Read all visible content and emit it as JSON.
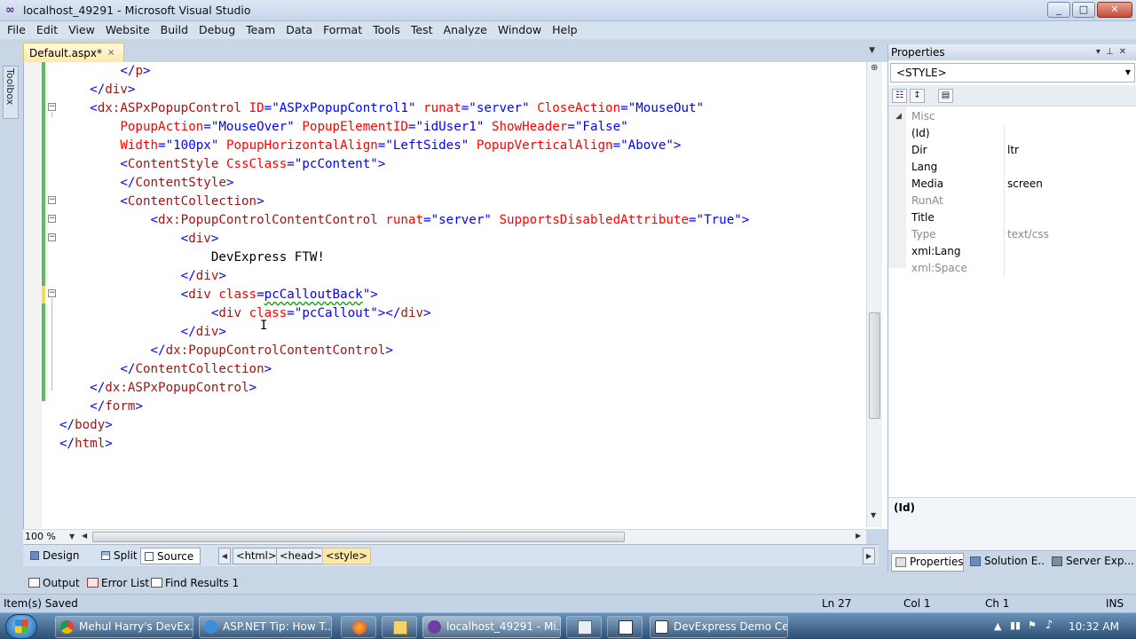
{
  "window": {
    "title": "localhost_49291 - Microsoft Visual Studio",
    "controls": [
      "_",
      "□",
      "✕"
    ]
  },
  "menu": [
    "File",
    "Edit",
    "View",
    "Website",
    "Build",
    "Debug",
    "Team",
    "Data",
    "Format",
    "Tools",
    "Test",
    "Analyze",
    "Window",
    "Help"
  ],
  "tab": {
    "label": "Default.aspx*",
    "close": "×"
  },
  "toolbox": {
    "label": "Toolbox"
  },
  "code": {
    "lines": [
      [
        {
          "c": "",
          "t": "        "
        },
        {
          "c": "b",
          "t": "</"
        },
        {
          "c": "m",
          "t": "p"
        },
        {
          "c": "b",
          "t": ">"
        }
      ],
      [
        {
          "c": "",
          "t": "    "
        },
        {
          "c": "b",
          "t": "</"
        },
        {
          "c": "m",
          "t": "div"
        },
        {
          "c": "b",
          "t": ">"
        }
      ],
      [
        {
          "c": "",
          "t": "    "
        },
        {
          "c": "b",
          "t": "<"
        },
        {
          "c": "m",
          "t": "dx:ASPxPopupControl"
        },
        {
          "c": "",
          "t": " "
        },
        {
          "c": "r",
          "t": "ID"
        },
        {
          "c": "b",
          "t": "=\"ASPxPopupControl1\""
        },
        {
          "c": "",
          "t": " "
        },
        {
          "c": "r",
          "t": "runat"
        },
        {
          "c": "b",
          "t": "=\"server\""
        },
        {
          "c": "",
          "t": " "
        },
        {
          "c": "r",
          "t": "CloseAction"
        },
        {
          "c": "b",
          "t": "=\"MouseOut\""
        }
      ],
      [
        {
          "c": "",
          "t": "        "
        },
        {
          "c": "r",
          "t": "PopupAction"
        },
        {
          "c": "b",
          "t": "=\"MouseOver\""
        },
        {
          "c": "",
          "t": " "
        },
        {
          "c": "r",
          "t": "PopupElementID"
        },
        {
          "c": "b",
          "t": "=\"idUser1\""
        },
        {
          "c": "",
          "t": " "
        },
        {
          "c": "r",
          "t": "ShowHeader"
        },
        {
          "c": "b",
          "t": "=\"False\""
        }
      ],
      [
        {
          "c": "",
          "t": "        "
        },
        {
          "c": "r",
          "t": "Width"
        },
        {
          "c": "b",
          "t": "=\"100px\""
        },
        {
          "c": "",
          "t": " "
        },
        {
          "c": "r",
          "t": "PopupHorizontalAlign"
        },
        {
          "c": "b",
          "t": "=\"LeftSides\""
        },
        {
          "c": "",
          "t": " "
        },
        {
          "c": "r",
          "t": "PopupVerticalAlign"
        },
        {
          "c": "b",
          "t": "=\"Above\">"
        }
      ],
      [
        {
          "c": "",
          "t": "        "
        },
        {
          "c": "b",
          "t": "<"
        },
        {
          "c": "m",
          "t": "ContentStyle"
        },
        {
          "c": "",
          "t": " "
        },
        {
          "c": "r",
          "t": "CssClass"
        },
        {
          "c": "b",
          "t": "=\"pcContent\">"
        }
      ],
      [
        {
          "c": "",
          "t": "        "
        },
        {
          "c": "b",
          "t": "</"
        },
        {
          "c": "m",
          "t": "ContentStyle"
        },
        {
          "c": "b",
          "t": ">"
        }
      ],
      [
        {
          "c": "",
          "t": "        "
        },
        {
          "c": "b",
          "t": "<"
        },
        {
          "c": "m",
          "t": "ContentCollection"
        },
        {
          "c": "b",
          "t": ">"
        }
      ],
      [
        {
          "c": "",
          "t": "            "
        },
        {
          "c": "b",
          "t": "<"
        },
        {
          "c": "m",
          "t": "dx:PopupControlContentControl"
        },
        {
          "c": "",
          "t": " "
        },
        {
          "c": "r",
          "t": "runat"
        },
        {
          "c": "b",
          "t": "=\"server\""
        },
        {
          "c": "",
          "t": " "
        },
        {
          "c": "r",
          "t": "SupportsDisabledAttribute"
        },
        {
          "c": "b",
          "t": "=\"True\">"
        }
      ],
      [
        {
          "c": "",
          "t": "                "
        },
        {
          "c": "b",
          "t": "<"
        },
        {
          "c": "m",
          "t": "div"
        },
        {
          "c": "b",
          "t": ">"
        }
      ],
      [
        {
          "c": "",
          "t": "                    DevExpress FTW!"
        }
      ],
      [
        {
          "c": "",
          "t": "                "
        },
        {
          "c": "b",
          "t": "</"
        },
        {
          "c": "m",
          "t": "div"
        },
        {
          "c": "b",
          "t": ">"
        }
      ],
      [
        {
          "c": "",
          "t": "                "
        },
        {
          "c": "b",
          "t": "<"
        },
        {
          "c": "m",
          "t": "div"
        },
        {
          "c": "",
          "t": " "
        },
        {
          "c": "r",
          "t": "class"
        },
        {
          "c": "b",
          "t": "="
        },
        {
          "c": "b sq",
          "t": "pcCalloutBack"
        },
        {
          "c": "b",
          "t": "\">"
        }
      ],
      [
        {
          "c": "",
          "t": "                    "
        },
        {
          "c": "b",
          "t": "<"
        },
        {
          "c": "m",
          "t": "div"
        },
        {
          "c": "",
          "t": " "
        },
        {
          "c": "r",
          "t": "class"
        },
        {
          "c": "b",
          "t": "=\"pcCallout\"></"
        },
        {
          "c": "m",
          "t": "div"
        },
        {
          "c": "b",
          "t": ">"
        }
      ],
      [
        {
          "c": "",
          "t": "                "
        },
        {
          "c": "b",
          "t": "</"
        },
        {
          "c": "m",
          "t": "div"
        },
        {
          "c": "b",
          "t": ">"
        }
      ],
      [
        {
          "c": "",
          "t": "            "
        },
        {
          "c": "b",
          "t": "</"
        },
        {
          "c": "m",
          "t": "dx:PopupControlContentControl"
        },
        {
          "c": "b",
          "t": ">"
        }
      ],
      [
        {
          "c": "",
          "t": "        "
        },
        {
          "c": "b",
          "t": "</"
        },
        {
          "c": "m",
          "t": "ContentCollection"
        },
        {
          "c": "b",
          "t": ">"
        }
      ],
      [
        {
          "c": "",
          "t": "    "
        },
        {
          "c": "b",
          "t": "</"
        },
        {
          "c": "m",
          "t": "dx:ASPxPopupControl"
        },
        {
          "c": "b",
          "t": ">"
        }
      ],
      [
        {
          "c": "",
          "t": "    "
        },
        {
          "c": "b",
          "t": "</"
        },
        {
          "c": "m",
          "t": "form"
        },
        {
          "c": "b",
          "t": ">"
        }
      ],
      [
        {
          "c": "b",
          "t": "</"
        },
        {
          "c": "m",
          "t": "body"
        },
        {
          "c": "b",
          "t": ">"
        }
      ],
      [
        {
          "c": "b",
          "t": "</"
        },
        {
          "c": "m",
          "t": "html"
        },
        {
          "c": "b",
          "t": ">"
        }
      ]
    ]
  },
  "zoom": {
    "value": "100 %"
  },
  "views": {
    "design": "Design",
    "split": "Split",
    "source": "Source"
  },
  "breadcrumbs": [
    "<html>",
    "<head>",
    "<style>"
  ],
  "properties": {
    "title": "Properties",
    "object": "<STYLE>",
    "category": "Misc",
    "rows": [
      {
        "name": "(Id)",
        "value": "",
        "gray": false
      },
      {
        "name": "Dir",
        "value": "ltr",
        "gray": false
      },
      {
        "name": "Lang",
        "value": "",
        "gray": false
      },
      {
        "name": "Media",
        "value": "screen",
        "gray": false
      },
      {
        "name": "RunAt",
        "value": "",
        "gray": true
      },
      {
        "name": "Title",
        "value": "",
        "gray": false
      },
      {
        "name": "Type",
        "value": "text/css",
        "gray": true
      },
      {
        "name": "xml:Lang",
        "value": "",
        "gray": false
      },
      {
        "name": "xml:Space",
        "value": "",
        "gray": true
      }
    ],
    "description": "(Id)",
    "tabs": [
      "Properties",
      "Solution E...",
      "Server Exp..."
    ]
  },
  "output_tabs": [
    "Output",
    "Error List",
    "Find Results 1"
  ],
  "status": {
    "message": "Item(s) Saved",
    "ln": "Ln 27",
    "col": "Col 1",
    "ch": "Ch 1",
    "mode": "INS"
  },
  "taskbar": {
    "buttons": [
      "Mehul Harry's DevEx...",
      "ASP.NET Tip: How T...",
      "localhost_49291 - Mi...",
      "DevExpress Demo Ce..."
    ],
    "clock": "10:32 AM"
  }
}
